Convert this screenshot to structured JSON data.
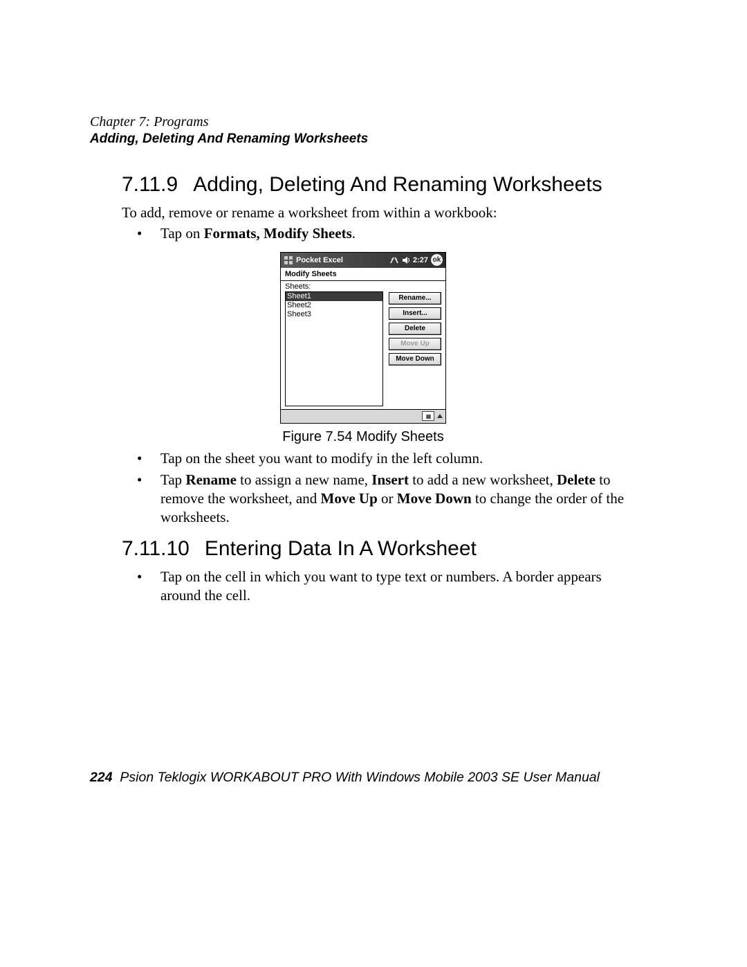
{
  "header": {
    "chapter": "Chapter 7: Programs",
    "section": "Adding, Deleting And Renaming Worksheets"
  },
  "sections": {
    "a": {
      "num": "7.11.9",
      "title": "Adding, Deleting And Renaming Worksheets",
      "intro": "To add, remove or rename a worksheet from within a workbook:",
      "bullet1_pre": "Tap on ",
      "bullet1_bold": "Formats, Modify Sheets",
      "bullet1_post": ".",
      "bullet2": "Tap on the sheet you want to modify in the left column.",
      "bullet3_parts": {
        "t0": "Tap ",
        "b0": "Rename",
        "t1": " to assign a new name, ",
        "b1": "Insert",
        "t2": " to add a new worksheet, ",
        "b2": "Delete",
        "t3": " to remove the worksheet, and ",
        "b3": "Move Up",
        "t4": " or ",
        "b4": "Move Down",
        "t5": " to change the order of the worksheets."
      }
    },
    "b": {
      "num": "7.11.10",
      "title": "Entering Data In A Worksheet",
      "bullet1": "Tap on the cell in which you want to type text or numbers. A border appears around the cell."
    }
  },
  "figure": {
    "caption": "Figure 7.54 Modify Sheets",
    "app_title": "Pocket Excel",
    "time": "2:27",
    "ok": "ok",
    "dialog_title": "Modify Sheets",
    "list_label": "Sheets:",
    "sheets": {
      "s0": "Sheet1",
      "s1": "Sheet2",
      "s2": "Sheet3"
    },
    "buttons": {
      "rename": "Rename...",
      "insert": "Insert...",
      "delete": "Delete",
      "moveup": "Move Up",
      "movedown": "Move Down"
    }
  },
  "footer": {
    "page": "224",
    "text": "Psion Teklogix WORKABOUT PRO With Windows Mobile 2003 SE User Manual"
  }
}
